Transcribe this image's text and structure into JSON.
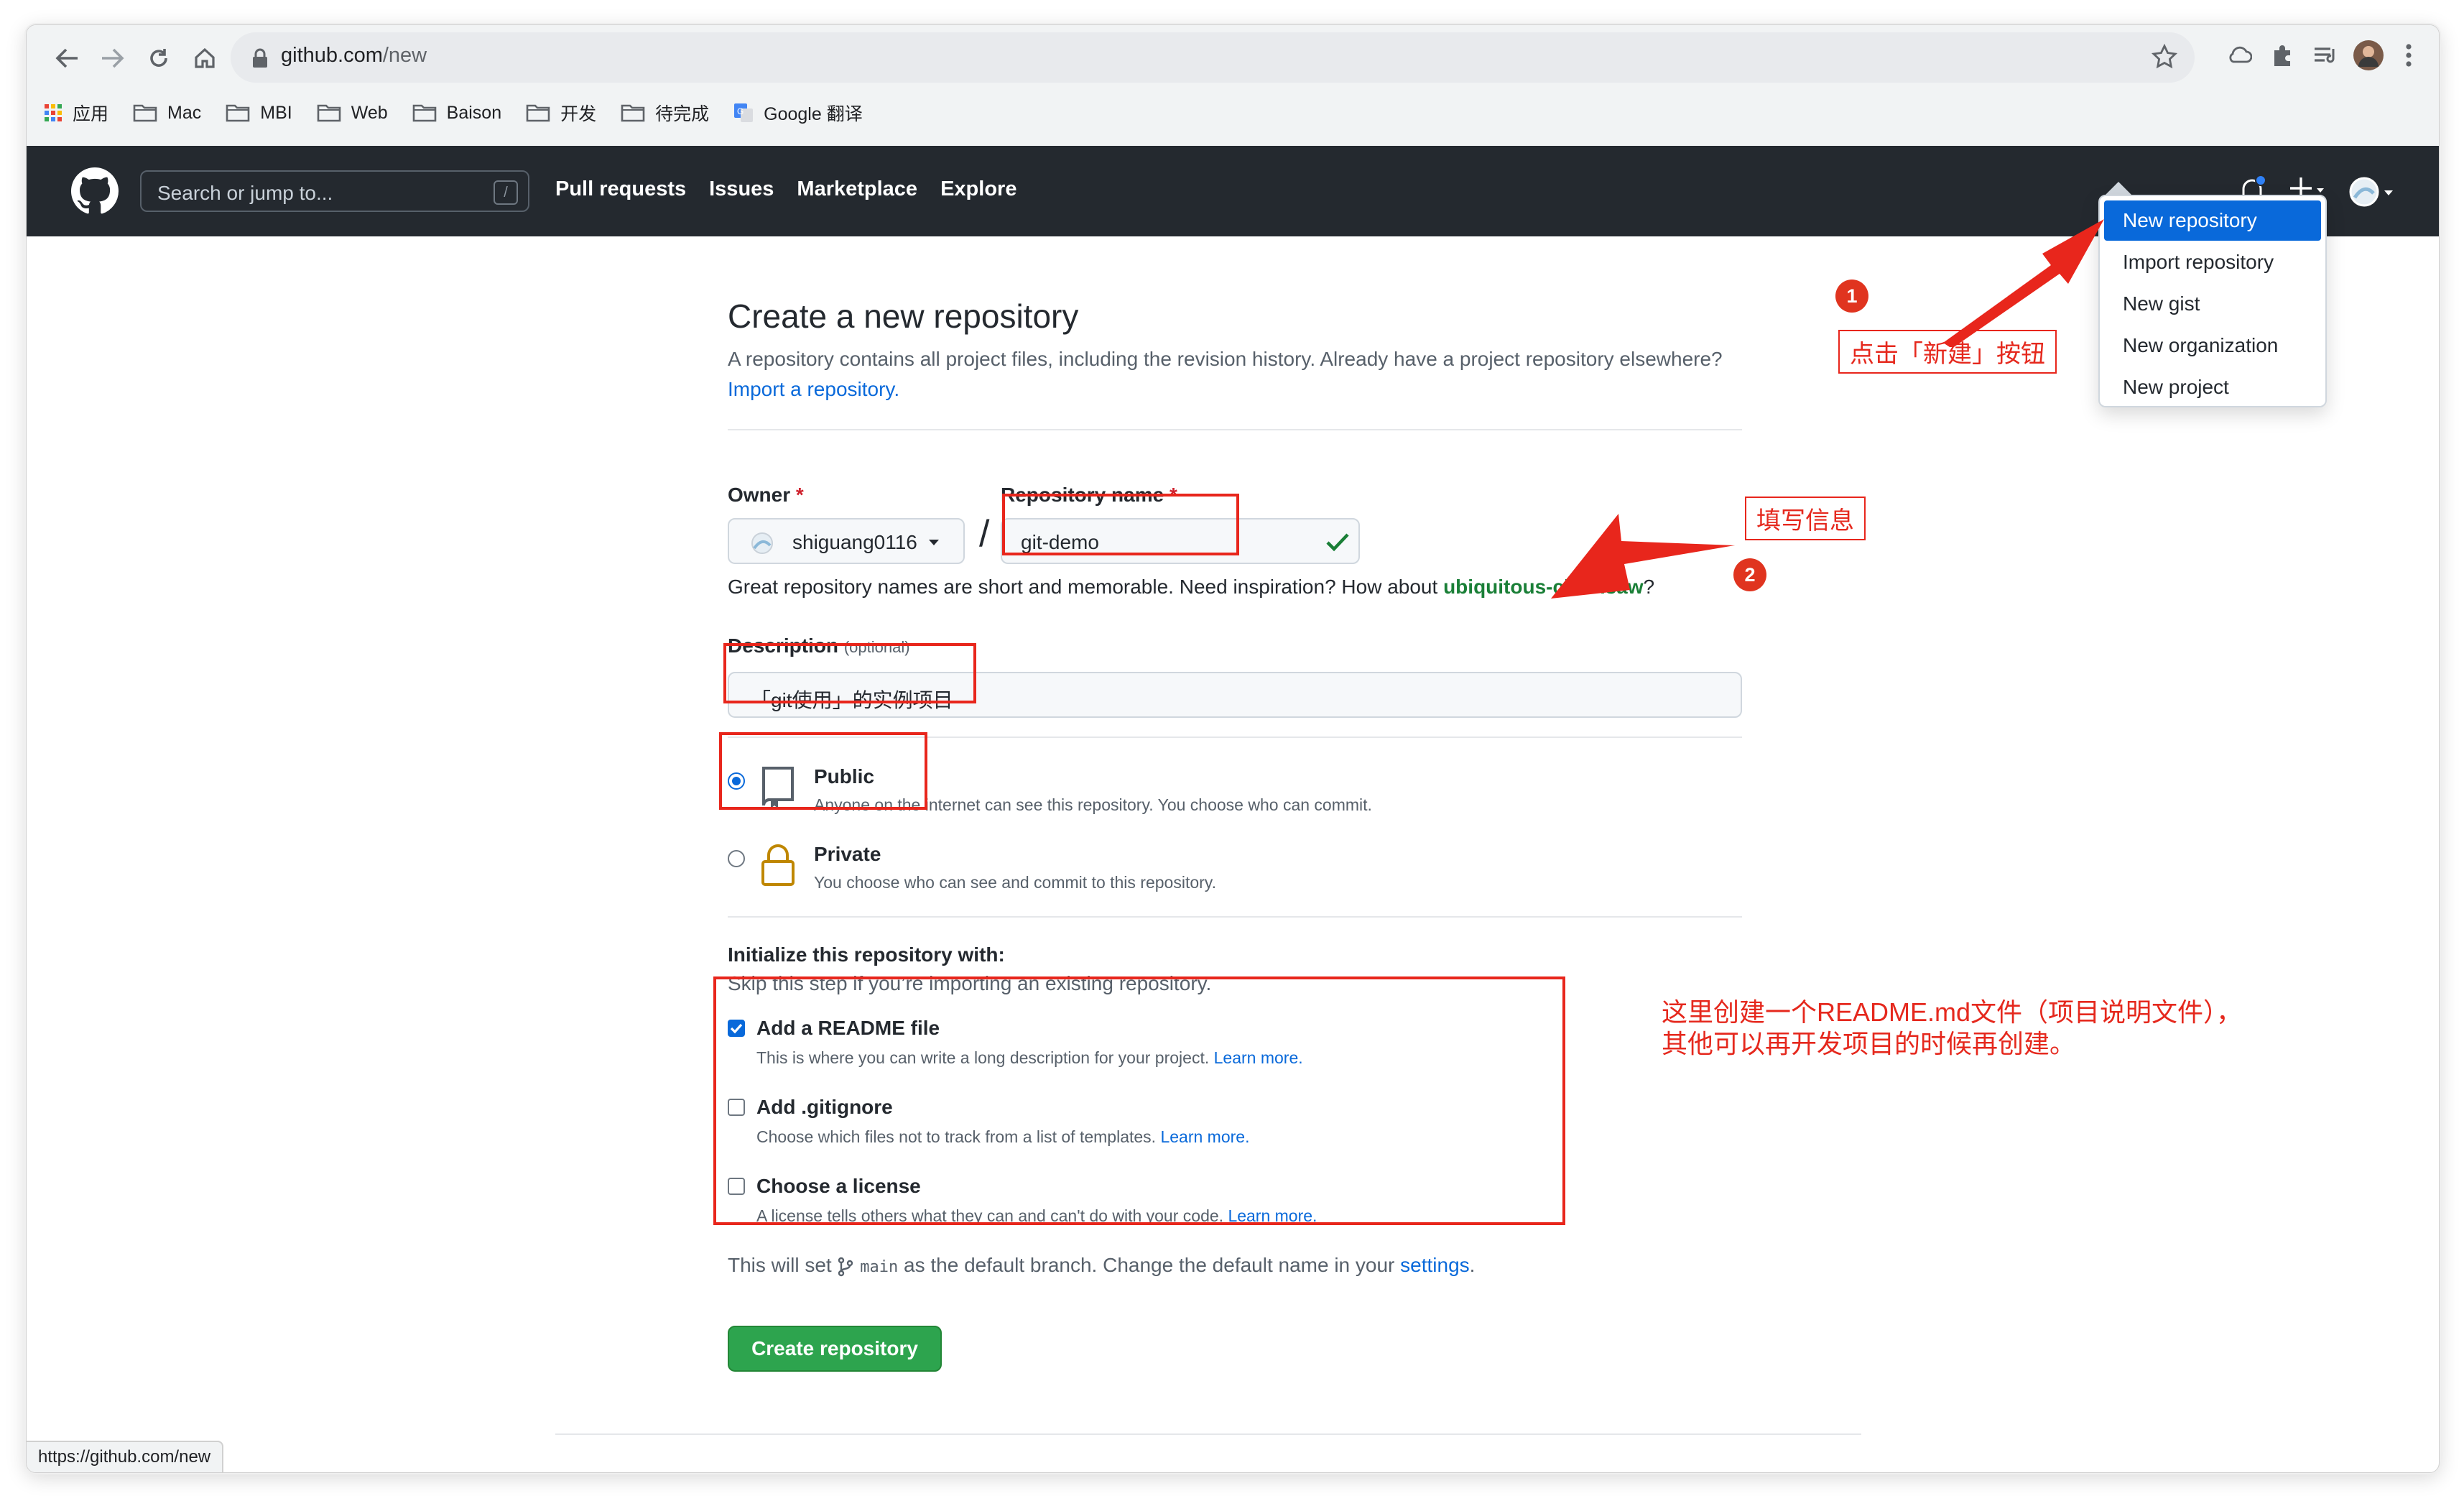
{
  "browser": {
    "url_host": "github.com",
    "url_path": "/new",
    "bookmarks": [
      "应用",
      "Mac",
      "MBI",
      "Web",
      "Baison",
      "开发",
      "待完成",
      "Google 翻译"
    ],
    "status_url": "https://github.com/new"
  },
  "header": {
    "search_placeholder": "Search or jump to...",
    "search_key": "/",
    "nav": [
      "Pull requests",
      "Issues",
      "Marketplace",
      "Explore"
    ]
  },
  "dropdown": {
    "items": [
      "New repository",
      "Import repository",
      "New gist",
      "New organization",
      "New project"
    ],
    "active_index": 0
  },
  "page": {
    "title": "Create a new repository",
    "lede": "A repository contains all project files, including the revision history. Already have a project repository elsewhere?",
    "lede_link": "Import a repository.",
    "owner_label": "Owner",
    "repo_label": "Repository name",
    "required_mark": "*",
    "owner_value": "shiguang0116",
    "slash": "/",
    "repo_value": "git-demo",
    "hint_prefix": "Great repository names are short and memorable. Need inspiration? How about",
    "hint_suggestion": "ubiquitous-chainsaw",
    "hint_suffix": "?",
    "description_label": "Description",
    "description_optional": "(optional)",
    "description_value": "「git使用」的实例项目",
    "public_title": "Public",
    "public_desc": "Anyone on the internet can see this repository. You choose who can commit.",
    "private_title": "Private",
    "private_desc": "You choose who can see and commit to this repository.",
    "init_title": "Initialize this repository with:",
    "init_sub": "Skip this step if you’re importing an existing repository.",
    "options": [
      {
        "title": "Add a README file",
        "desc": "This is where you can write a long description for your project.",
        "link": "Learn more.",
        "checked": true
      },
      {
        "title": "Add .gitignore",
        "desc": "Choose which files not to track from a list of templates.",
        "link": "Learn more.",
        "checked": false
      },
      {
        "title": "Choose a license",
        "desc": "A license tells others what they can and can't do with your code.",
        "link": "Learn more.",
        "checked": false
      }
    ],
    "branch_prefix": "This will set",
    "branch_name": "main",
    "branch_suffix": "as the default branch. Change the default name in your",
    "branch_link": "settings",
    "branch_end": ".",
    "create_button": "Create repository"
  },
  "annotations": {
    "marker1": "1",
    "marker2": "2",
    "callout1": "点击「新建」按钮",
    "callout2": "填写信息",
    "note_line1": "这里创建一个README.md文件（项目说明文件），",
    "note_line2": "其他可以再开发项目的时候再创建。"
  },
  "colors": {
    "annotation_red": "#e8261c",
    "github_header": "#24292f",
    "primary_button": "#2da44e",
    "link_blue": "#0969da"
  }
}
